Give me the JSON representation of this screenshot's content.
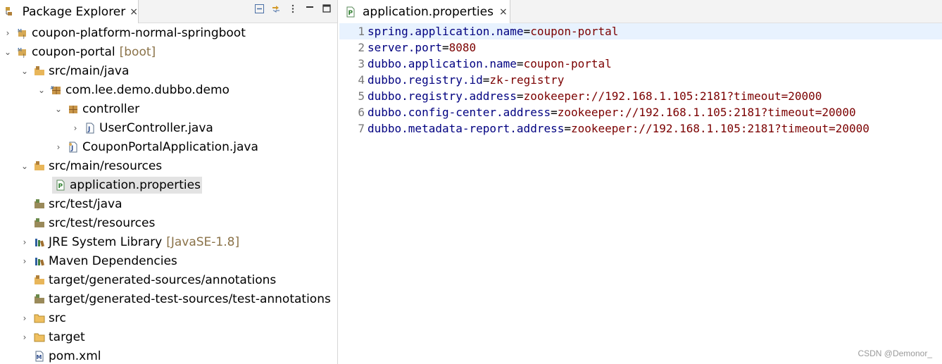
{
  "explorer": {
    "title": "Package Explorer",
    "close": "×",
    "items": [
      {
        "label": "coupon-platform-normal-springboot",
        "decor": ""
      },
      {
        "label": "coupon-portal",
        "decor": "[boot]"
      },
      {
        "label": "src/main/java",
        "decor": ""
      },
      {
        "label": "com.lee.demo.dubbo.demo",
        "decor": ""
      },
      {
        "label": "controller",
        "decor": ""
      },
      {
        "label": "UserController.java",
        "decor": ""
      },
      {
        "label": "CouponPortalApplication.java",
        "decor": ""
      },
      {
        "label": "src/main/resources",
        "decor": ""
      },
      {
        "label": "application.properties",
        "decor": ""
      },
      {
        "label": "src/test/java",
        "decor": ""
      },
      {
        "label": "src/test/resources",
        "decor": ""
      },
      {
        "label": "JRE System Library",
        "decor": "[JavaSE-1.8]"
      },
      {
        "label": "Maven Dependencies",
        "decor": ""
      },
      {
        "label": "target/generated-sources/annotations",
        "decor": ""
      },
      {
        "label": "target/generated-test-sources/test-annotations",
        "decor": ""
      },
      {
        "label": "src",
        "decor": ""
      },
      {
        "label": "target",
        "decor": ""
      },
      {
        "label": "pom.xml",
        "decor": ""
      }
    ]
  },
  "editor": {
    "tab_title": "application.properties",
    "close": "×",
    "lines": [
      {
        "n": "1",
        "key": "spring.application.name",
        "value": "coupon-portal"
      },
      {
        "n": "2",
        "key": "server.port",
        "value": "8080"
      },
      {
        "n": "3",
        "key": "dubbo.application.name",
        "value": "coupon-portal"
      },
      {
        "n": "4",
        "key": "dubbo.registry.id",
        "value": "zk-registry"
      },
      {
        "n": "5",
        "key": "dubbo.registry.address",
        "value": "zookeeper://192.168.1.105:2181?timeout=20000"
      },
      {
        "n": "6",
        "key": "dubbo.config-center.address",
        "value": "zookeeper://192.168.1.105:2181?timeout=20000"
      },
      {
        "n": "7",
        "key": "dubbo.metadata-report.address",
        "value": "zookeeper://192.168.1.105:2181?timeout=20000"
      }
    ]
  },
  "watermark": "CSDN @Demonor_"
}
